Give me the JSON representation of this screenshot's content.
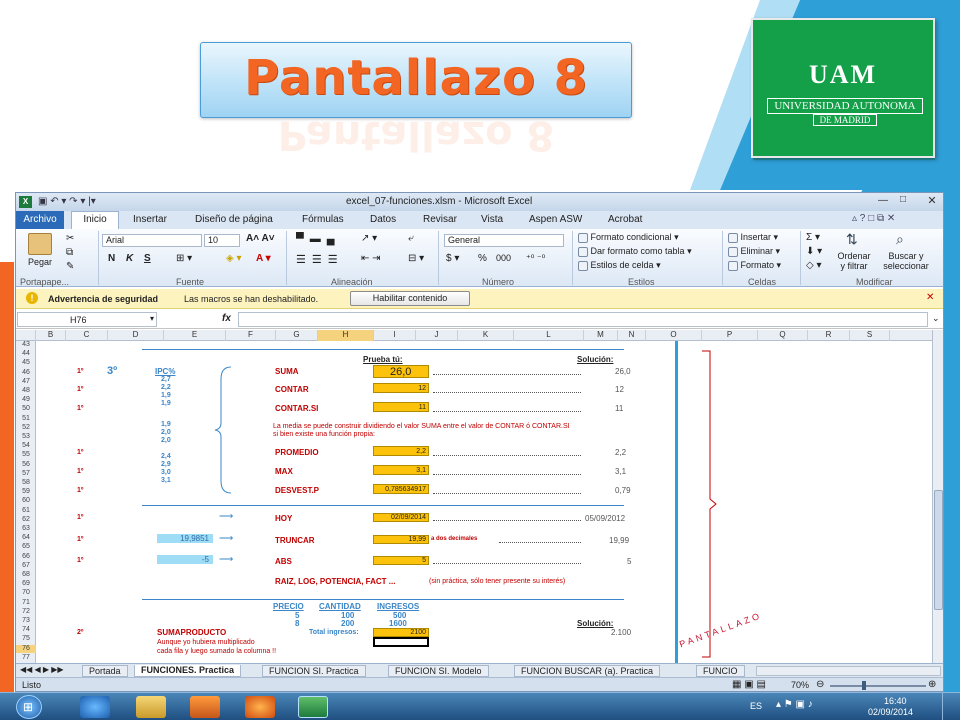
{
  "slide": {
    "title": "Pantallazo 8",
    "side_caption": "PANTALLAZO"
  },
  "logo": {
    "line0": "UAM",
    "line1": "UNIVERSIDAD AUTONOMA",
    "line2": "DE MADRID"
  },
  "window": {
    "title": "excel_07-funciones.xlsm - Microsoft Excel"
  },
  "ribbon_tabs": [
    "Archivo",
    "Inicio",
    "Insertar",
    "Diseño de página",
    "Fórmulas",
    "Datos",
    "Revisar",
    "Vista",
    "Aspen ASW",
    "Acrobat"
  ],
  "ribbon": {
    "paste_label": "Pegar",
    "font_name": "Arial",
    "font_size": "10",
    "number_format": "General",
    "bold": "N",
    "italic": "K",
    "underline": "S",
    "percent": "%",
    "thousands": "000",
    "cond_format": "Formato condicional",
    "table_format": "Dar formato como tabla",
    "cell_styles": "Estilos de celda",
    "insert": "Insertar",
    "delete": "Eliminar",
    "format": "Formato",
    "sort_filter_1": "Ordenar",
    "sort_filter_2": "y filtrar",
    "find_1": "Buscar y",
    "find_2": "seleccionar",
    "groups": [
      "Portapape...",
      "Fuente",
      "Alineación",
      "Número",
      "Estilos",
      "Celdas",
      "Modificar"
    ]
  },
  "security_bar": {
    "title": "Advertencia de seguridad",
    "message": "Las macros se han deshabilitado.",
    "button": "Habilitar contenido"
  },
  "formula_bar": {
    "name_box": "H76",
    "fx": "fx",
    "value": ""
  },
  "columns": [
    "B",
    "C",
    "D",
    "E",
    "F",
    "G",
    "H",
    "I",
    "J",
    "K",
    "L",
    "M",
    "N",
    "O",
    "P",
    "Q",
    "R",
    "S"
  ],
  "row_numbers": [
    "43",
    "44",
    "45",
    "46",
    "47",
    "48",
    "49",
    "50",
    "51",
    "52",
    "53",
    "54",
    "55",
    "56",
    "57",
    "58",
    "59",
    "60",
    "61",
    "62",
    "63",
    "64",
    "65",
    "66",
    "67",
    "68",
    "69",
    "70",
    "71",
    "72",
    "73",
    "74",
    "75",
    "76",
    "77"
  ],
  "sheet": {
    "section_number": "3º",
    "prueba": "Prueba tú:",
    "solucion": "Solución:",
    "ipc_header": "IPC%",
    "ipc_values": [
      "2,7",
      "2,2",
      "1,9",
      "1,9",
      "1,9",
      "2,0",
      "2,0",
      "2,4",
      "2,9",
      "3,0",
      "3,1"
    ],
    "functions": [
      {
        "mark": "1º",
        "name": "SUMA",
        "try": "26,0",
        "sol": "26,0"
      },
      {
        "mark": "1º",
        "name": "CONTAR",
        "try": "12",
        "sol": "12"
      },
      {
        "mark": "1º",
        "name": "CONTAR.SI",
        "try": "11",
        "sol": "11"
      },
      {
        "mark": "1º",
        "name": "PROMEDIO",
        "try": "2,2",
        "sol": "2,2"
      },
      {
        "mark": "1º",
        "name": "MAX",
        "try": "3,1",
        "sol": "3,1"
      },
      {
        "mark": "1º",
        "name": "DESVEST.P",
        "try": "0,785634917",
        "sol": "0,79"
      }
    ],
    "media_note_1": "La media se puede construir dividiendo el valor SUMA entre el valor de CONTAR ó CONTAR.SI",
    "media_note_2": "si bien existe una función propia:",
    "hoy": {
      "mark": "1º",
      "name": "HOY",
      "try": "02/09/2014",
      "sol": "05/09/2012"
    },
    "truncar": {
      "mark": "1º",
      "input": "19,9851",
      "name": "TRUNCAR",
      "try": "19,99",
      "suffix": "a dos decimales",
      "sol": "19,99"
    },
    "abs": {
      "mark": "1º",
      "input": "-5",
      "name": "ABS",
      "try": "5",
      "sol": "5"
    },
    "raiz": "RAIZ, LOG, POTENCIA, FACT ...",
    "raiz_note": "(sin práctica, sólo tener presente su interés)",
    "sp_headers": [
      "PRECIO",
      "CANTIDAD",
      "INGRESOS"
    ],
    "sp_rows": [
      [
        "5",
        "100",
        "500"
      ],
      [
        "8",
        "200",
        "1600"
      ]
    ],
    "sp_solucion": "Solución:",
    "sp_mark": "2º",
    "sp_name": "SUMAPRODUCTO",
    "sp_total_label": "Total ingresos:",
    "sp_try": "2100",
    "sp_sol": "2.100",
    "sp_note_1": "Aunque yo hubiera multiplicado",
    "sp_note_2": "cada fila y luego sumado la columna !!"
  },
  "sheet_tabs": [
    "Portada",
    "FUNCIONES. Practica",
    "FUNCION SI. Practica",
    "FUNCION SI. Modelo",
    "FUNCION BUSCAR (a). Practica",
    "FUNCIO"
  ],
  "status": {
    "ready": "Listo",
    "zoom": "70%"
  },
  "taskbar": {
    "lang": "ES",
    "time": "16:40",
    "date": "02/09/2014"
  }
}
